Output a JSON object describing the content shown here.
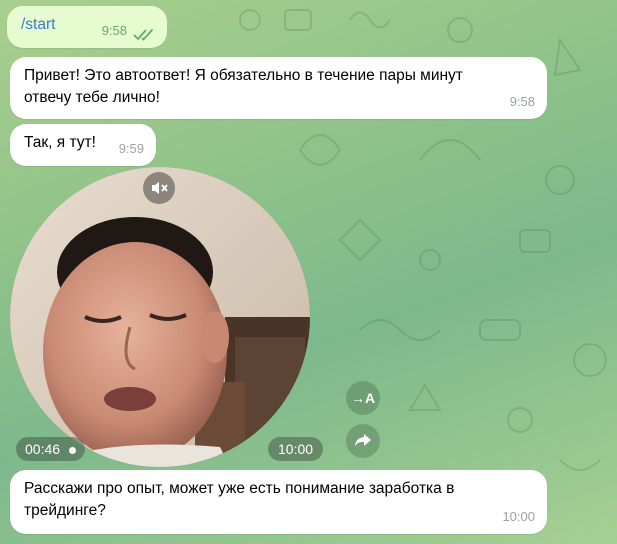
{
  "messages": [
    {
      "id": "m1",
      "direction": "out",
      "text": "/start",
      "time": "9:58",
      "status": "read"
    },
    {
      "id": "m2",
      "direction": "in",
      "text_line1": "Привет! Это автоответ! Я обязательно в течение пары минут",
      "text_line2": "отвечу тебе лично!",
      "time": "9:58"
    },
    {
      "id": "m3",
      "direction": "in",
      "text": "Так, я тут!",
      "time": "9:59"
    },
    {
      "id": "m4",
      "direction": "in",
      "type": "video_note",
      "duration": "00:46",
      "time": "10:00",
      "muted": true
    },
    {
      "id": "m5",
      "direction": "in",
      "text_line1": "Расскажи про опыт, может уже есть понимание заработка в",
      "text_line2": "трейдинге?",
      "time": "10:00"
    }
  ],
  "actions": {
    "translate_label": "→A",
    "forward_icon": "forward-arrow-icon"
  },
  "colors": {
    "outgoing_bubble": "#e6fbd0",
    "incoming_bubble": "#ffffff",
    "link": "#3a7fc4",
    "read_checks": "#5fae5a"
  }
}
